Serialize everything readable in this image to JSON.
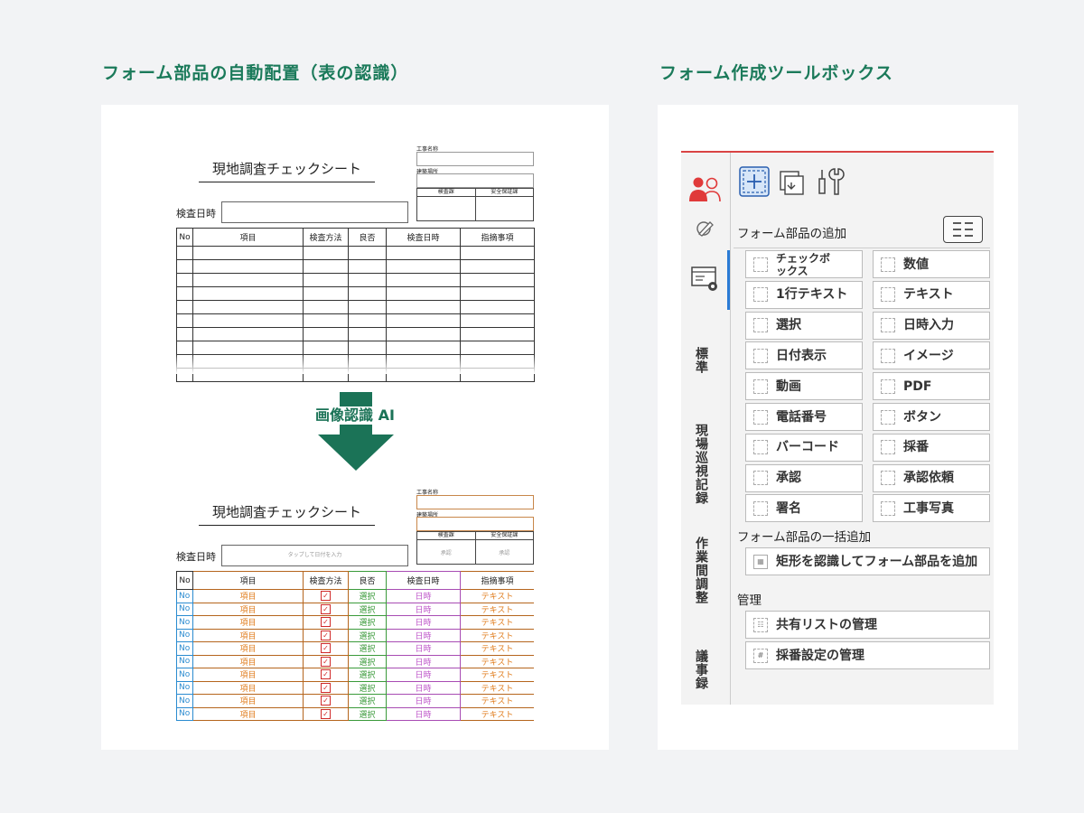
{
  "headings": {
    "left": "フォーム部品の自動配置（表の認識）",
    "right": "フォーム作成ツールボックス"
  },
  "sheet": {
    "title": "現地調査チェックシート",
    "meta_labels": [
      "工事名称",
      "建築場所"
    ],
    "approval_headers": [
      "検査課",
      "安全保証課"
    ],
    "approval_after": [
      "承認",
      "承認"
    ],
    "date_label": "検査日時",
    "date_placeholder": "タップして日付を入力",
    "columns": [
      "No",
      "項目",
      "検査方法",
      "良否",
      "検査日時",
      "指摘事項"
    ]
  },
  "ai_label": "画像認識 AI",
  "recognized_row": {
    "no": "No",
    "item": "項目",
    "check": "✓",
    "select": "選択",
    "date": "日時",
    "text": "テキスト"
  },
  "toolbox": {
    "rail_tabs": [
      "標準",
      "現場巡視記録",
      "作業間調整",
      "議事録"
    ],
    "add_title": "フォーム部品の追加",
    "buttons": [
      {
        "label": "チェックボックス",
        "icon": "checkbox-icon"
      },
      {
        "label": "数値",
        "icon": "number-icon"
      },
      {
        "label": "1行テキスト",
        "icon": "single-line-text-icon"
      },
      {
        "label": "テキスト",
        "icon": "text-icon"
      },
      {
        "label": "選択",
        "icon": "select-icon"
      },
      {
        "label": "日時入力",
        "icon": "datetime-input-icon"
      },
      {
        "label": "日付表示",
        "icon": "date-display-icon"
      },
      {
        "label": "イメージ",
        "icon": "image-icon"
      },
      {
        "label": "動画",
        "icon": "video-icon"
      },
      {
        "label": "PDF",
        "icon": "pdf-icon"
      },
      {
        "label": "電話番号",
        "icon": "phone-icon"
      },
      {
        "label": "ボタン",
        "icon": "button-icon"
      },
      {
        "label": "バーコード",
        "icon": "barcode-icon"
      },
      {
        "label": "採番",
        "icon": "numbering-icon"
      },
      {
        "label": "承認",
        "icon": "approval-icon"
      },
      {
        "label": "承認依頼",
        "icon": "approval-request-icon"
      },
      {
        "label": "署名",
        "icon": "signature-icon"
      },
      {
        "label": "工事写真",
        "icon": "construction-photo-icon"
      }
    ],
    "bulk_title": "フォーム部品の一括追加",
    "bulk_button": "矩形を認識してフォーム部品を追加",
    "manage_title": "管理",
    "manage_buttons": [
      "共有リストの管理",
      "採番設定の管理"
    ]
  }
}
